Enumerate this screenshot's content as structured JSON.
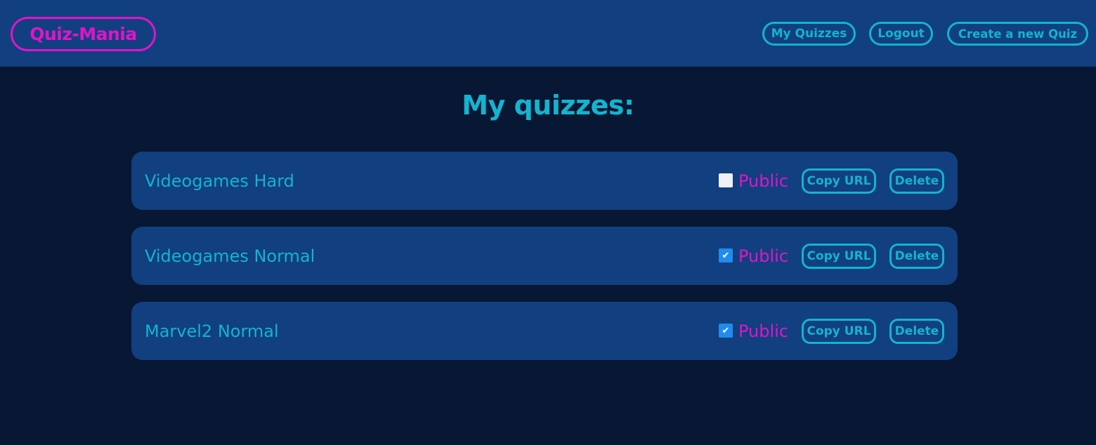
{
  "header": {
    "logo": "Quiz-Mania",
    "nav": {
      "my_quizzes": "My Quizzes",
      "logout": "Logout",
      "create": "Create a new Quiz"
    }
  },
  "main": {
    "title": "My quizzes:",
    "quizzes": [
      {
        "name": "Videogames Hard",
        "public": false,
        "public_label": "Public",
        "copy_label": "Copy URL",
        "delete_label": "Delete"
      },
      {
        "name": "Videogames Normal",
        "public": true,
        "public_label": "Public",
        "copy_label": "Copy URL",
        "delete_label": "Delete"
      },
      {
        "name": "Marvel2 Normal",
        "public": true,
        "public_label": "Public",
        "copy_label": "Copy URL",
        "delete_label": "Delete"
      }
    ]
  },
  "colors": {
    "background": "#081733",
    "panel": "#123f7f",
    "accent_cyan": "#13b4cf",
    "accent_magenta": "#e114c8",
    "checkbox_checked": "#1f8cf0"
  },
  "icons": {
    "check": "checkmark-icon"
  }
}
